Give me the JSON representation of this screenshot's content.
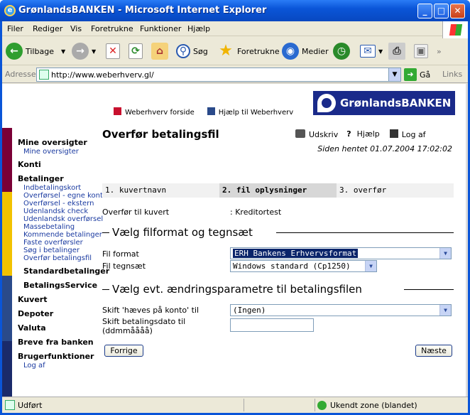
{
  "window": {
    "title": "GrønlandsBANKEN - Microsoft Internet Explorer"
  },
  "menu": [
    "Filer",
    "Rediger",
    "Vis",
    "Foretrukne",
    "Funktioner",
    "Hjælp"
  ],
  "toolbar": {
    "back": "Tilbage",
    "search": "Søg",
    "favorites": "Foretrukne",
    "media": "Medier"
  },
  "address": {
    "label": "Adresse",
    "url": "http://www.weberhverv.gl/",
    "go": "Gå",
    "links": "Links"
  },
  "page": {
    "toplinks": [
      {
        "label": "Weberhverv forside",
        "color": "#c8102e"
      },
      {
        "label": "Hjælp til Weberhverv",
        "color": "#2a4a8a"
      }
    ],
    "logo": "GrønlandsBANKEN",
    "leftbar_colors": [
      "#7a0036",
      "#f2c200",
      "#2a4a8a",
      "#1a2a6a"
    ],
    "nav": [
      {
        "type": "h",
        "label": "Mine oversigter"
      },
      {
        "type": "l",
        "label": "Mine oversigter"
      },
      {
        "type": "h",
        "label": "Konti"
      },
      {
        "type": "h",
        "label": "Betalinger"
      },
      {
        "type": "l",
        "label": "Indbetalingskort"
      },
      {
        "type": "l",
        "label": "Overførsel - egne konti"
      },
      {
        "type": "l",
        "label": "Overførsel - ekstern"
      },
      {
        "type": "l",
        "label": "Udenlandsk check"
      },
      {
        "type": "l",
        "label": "Udenlandsk overførsel"
      },
      {
        "type": "l",
        "label": "Massebetaling"
      },
      {
        "type": "l",
        "label": "Kommende betalinger"
      },
      {
        "type": "l",
        "label": "Faste overførsler"
      },
      {
        "type": "l",
        "label": "Søg i betalinger"
      },
      {
        "type": "l",
        "label": "Overfør betalingsfil"
      },
      {
        "type": "s",
        "label": "Standardbetalinger"
      },
      {
        "type": "s",
        "label": "BetalingsService"
      },
      {
        "type": "h",
        "label": "Kuvert"
      },
      {
        "type": "h",
        "label": "Depoter"
      },
      {
        "type": "h",
        "label": "Valuta"
      },
      {
        "type": "h",
        "label": "Breve fra banken"
      },
      {
        "type": "h",
        "label": "Brugerfunktioner"
      },
      {
        "type": "l",
        "label": "Log af"
      }
    ],
    "title": "Overfør betalingsfil",
    "tools": {
      "print": "Udskriv",
      "help": "Hjælp",
      "logoff": "Log af"
    },
    "fetched": "Siden hentet 01.07.2004 17:02:02",
    "steps": [
      "1. kuvertnavn",
      "2. fil oplysninger",
      "3. overfør"
    ],
    "transfer_label": "Overfør til kuvert",
    "transfer_value": ": Kreditortest",
    "section1": "Vælg filformat og tegnsæt",
    "format_label": "Fil format",
    "format_value": "ERH Bankens Erhvervsformat",
    "charset_label": "Fil tegnsæt",
    "charset_value": "Windows standard (Cp1250)",
    "section2": "Vælg evt. ændringsparametre til betalingsfilen",
    "debit_label": "Skift 'hæves på konto' til",
    "debit_value": "(Ingen)",
    "date_label1": "Skift betalingsdato til",
    "date_label2": "(ddmmåååå)",
    "date_value": "",
    "prev": "Forrige",
    "next": "Næste"
  },
  "status": {
    "text": "Udført",
    "zone": "Ukendt zone (blandet)"
  }
}
